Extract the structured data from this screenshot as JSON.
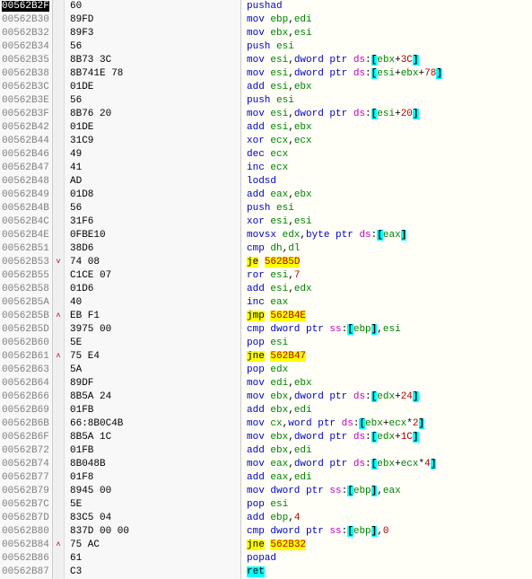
{
  "rows": [
    {
      "addr": "00562B2F",
      "addr_hl": true,
      "jmp": "",
      "bytes": "60",
      "asm": [
        [
          "mnem",
          "pushad"
        ]
      ]
    },
    {
      "addr": "00562B30",
      "jmp": "",
      "bytes": "89FD",
      "asm": [
        [
          "mnem",
          "mov "
        ],
        [
          "reg",
          "ebp"
        ],
        [
          "",
          ","
        ],
        [
          "reg",
          "edi"
        ]
      ]
    },
    {
      "addr": "00562B32",
      "jmp": "",
      "bytes": "89F3",
      "asm": [
        [
          "mnem",
          "mov "
        ],
        [
          "reg",
          "ebx"
        ],
        [
          "",
          ","
        ],
        [
          "reg",
          "esi"
        ]
      ]
    },
    {
      "addr": "00562B34",
      "jmp": "",
      "bytes": "56",
      "asm": [
        [
          "mnem",
          "push "
        ],
        [
          "reg",
          "esi"
        ]
      ]
    },
    {
      "addr": "00562B35",
      "jmp": "",
      "bytes": "8B73 3C",
      "asm": [
        [
          "mnem",
          "mov "
        ],
        [
          "reg",
          "esi"
        ],
        [
          "",
          ","
        ],
        [
          "mnem",
          "dword ptr "
        ],
        [
          "seg",
          "ds"
        ],
        [
          "",
          ":"
        ],
        [
          "brkt",
          "["
        ],
        [
          "reg",
          "ebx"
        ],
        [
          "",
          "+"
        ],
        [
          "num",
          "3C"
        ],
        [
          "brkt",
          "]"
        ]
      ]
    },
    {
      "addr": "00562B38",
      "jmp": "",
      "bytes": "8B741E 78",
      "asm": [
        [
          "mnem",
          "mov "
        ],
        [
          "reg",
          "esi"
        ],
        [
          "",
          ","
        ],
        [
          "mnem",
          "dword ptr "
        ],
        [
          "seg",
          "ds"
        ],
        [
          "",
          ":"
        ],
        [
          "brkt",
          "["
        ],
        [
          "reg",
          "esi"
        ],
        [
          "",
          "+"
        ],
        [
          "reg",
          "ebx"
        ],
        [
          "",
          "+"
        ],
        [
          "num",
          "78"
        ],
        [
          "brkt",
          "]"
        ]
      ]
    },
    {
      "addr": "00562B3C",
      "jmp": "",
      "bytes": "01DE",
      "asm": [
        [
          "mnem",
          "add "
        ],
        [
          "reg",
          "esi"
        ],
        [
          "",
          ","
        ],
        [
          "reg",
          "ebx"
        ]
      ]
    },
    {
      "addr": "00562B3E",
      "jmp": "",
      "bytes": "56",
      "asm": [
        [
          "mnem",
          "push "
        ],
        [
          "reg",
          "esi"
        ]
      ]
    },
    {
      "addr": "00562B3F",
      "jmp": "",
      "bytes": "8B76 20",
      "asm": [
        [
          "mnem",
          "mov "
        ],
        [
          "reg",
          "esi"
        ],
        [
          "",
          ","
        ],
        [
          "mnem",
          "dword ptr "
        ],
        [
          "seg",
          "ds"
        ],
        [
          "",
          ":"
        ],
        [
          "brkt",
          "["
        ],
        [
          "reg",
          "esi"
        ],
        [
          "",
          "+"
        ],
        [
          "num",
          "20"
        ],
        [
          "brkt",
          "]"
        ]
      ]
    },
    {
      "addr": "00562B42",
      "jmp": "",
      "bytes": "01DE",
      "asm": [
        [
          "mnem",
          "add "
        ],
        [
          "reg",
          "esi"
        ],
        [
          "",
          ","
        ],
        [
          "reg",
          "ebx"
        ]
      ]
    },
    {
      "addr": "00562B44",
      "jmp": "",
      "bytes": "31C9",
      "asm": [
        [
          "mnem",
          "xor "
        ],
        [
          "reg",
          "ecx"
        ],
        [
          "",
          ","
        ],
        [
          "reg",
          "ecx"
        ]
      ]
    },
    {
      "addr": "00562B46",
      "jmp": "",
      "bytes": "49",
      "asm": [
        [
          "mnem",
          "dec "
        ],
        [
          "reg",
          "ecx"
        ]
      ]
    },
    {
      "addr": "00562B47",
      "jmp": "",
      "bytes": "41",
      "asm": [
        [
          "mnem",
          "inc "
        ],
        [
          "reg",
          "ecx"
        ]
      ]
    },
    {
      "addr": "00562B48",
      "jmp": "",
      "bytes": "AD",
      "asm": [
        [
          "mnem",
          "lodsd"
        ]
      ]
    },
    {
      "addr": "00562B49",
      "jmp": "",
      "bytes": "01D8",
      "asm": [
        [
          "mnem",
          "add "
        ],
        [
          "reg",
          "eax"
        ],
        [
          "",
          ","
        ],
        [
          "reg",
          "ebx"
        ]
      ]
    },
    {
      "addr": "00562B4B",
      "jmp": "",
      "bytes": "56",
      "asm": [
        [
          "mnem",
          "push "
        ],
        [
          "reg",
          "esi"
        ]
      ]
    },
    {
      "addr": "00562B4C",
      "jmp": "",
      "bytes": "31F6",
      "asm": [
        [
          "mnem",
          "xor "
        ],
        [
          "reg",
          "esi"
        ],
        [
          "",
          ","
        ],
        [
          "reg",
          "esi"
        ]
      ]
    },
    {
      "addr": "00562B4E",
      "jmp": "",
      "bytes": "0FBE10",
      "asm": [
        [
          "mnem",
          "movsx "
        ],
        [
          "reg",
          "edx"
        ],
        [
          "",
          ","
        ],
        [
          "mnem",
          "byte ptr "
        ],
        [
          "seg",
          "ds"
        ],
        [
          "",
          ":"
        ],
        [
          "brkt",
          "["
        ],
        [
          "reg",
          "eax"
        ],
        [
          "brkt",
          "]"
        ]
      ]
    },
    {
      "addr": "00562B51",
      "jmp": "",
      "bytes": "38D6",
      "asm": [
        [
          "mnem",
          "cmp "
        ],
        [
          "reg",
          "dh"
        ],
        [
          "",
          ","
        ],
        [
          "reg",
          "dl"
        ]
      ]
    },
    {
      "addr": "00562B53",
      "jmp": "˅",
      "bytes": "74 08",
      "asm": [
        [
          "jmpm",
          "je"
        ],
        [
          "",
          " "
        ],
        [
          "tgt",
          "562B5D"
        ]
      ]
    },
    {
      "addr": "00562B55",
      "jmp": "",
      "bytes": "C1CE 07",
      "asm": [
        [
          "mnem",
          "ror "
        ],
        [
          "reg",
          "esi"
        ],
        [
          "",
          ","
        ],
        [
          "num",
          "7"
        ]
      ]
    },
    {
      "addr": "00562B58",
      "jmp": "",
      "bytes": "01D6",
      "asm": [
        [
          "mnem",
          "add "
        ],
        [
          "reg",
          "esi"
        ],
        [
          "",
          ","
        ],
        [
          "reg",
          "edx"
        ]
      ]
    },
    {
      "addr": "00562B5A",
      "jmp": "",
      "bytes": "40",
      "asm": [
        [
          "mnem",
          "inc "
        ],
        [
          "reg",
          "eax"
        ]
      ]
    },
    {
      "addr": "00562B5B",
      "jmp": "˄",
      "bytes": "EB F1",
      "asm": [
        [
          "jmpm",
          "jmp"
        ],
        [
          "",
          " "
        ],
        [
          "tgt",
          "562B4E"
        ]
      ]
    },
    {
      "addr": "00562B5D",
      "jmp": "",
      "bytes": "3975 00",
      "asm": [
        [
          "mnem",
          "cmp "
        ],
        [
          "mnem",
          "dword ptr "
        ],
        [
          "seg",
          "ss"
        ],
        [
          "",
          ":"
        ],
        [
          "brkt",
          "["
        ],
        [
          "reg",
          "ebp"
        ],
        [
          "brkt",
          "]"
        ],
        [
          "",
          ","
        ],
        [
          "reg",
          "esi"
        ]
      ]
    },
    {
      "addr": "00562B60",
      "jmp": "",
      "bytes": "5E",
      "asm": [
        [
          "mnem",
          "pop "
        ],
        [
          "reg",
          "esi"
        ]
      ]
    },
    {
      "addr": "00562B61",
      "jmp": "˄",
      "bytes": "75 E4",
      "asm": [
        [
          "jmpm",
          "jne"
        ],
        [
          "",
          " "
        ],
        [
          "tgt",
          "562B47"
        ]
      ]
    },
    {
      "addr": "00562B63",
      "jmp": "",
      "bytes": "5A",
      "asm": [
        [
          "mnem",
          "pop "
        ],
        [
          "reg",
          "edx"
        ]
      ]
    },
    {
      "addr": "00562B64",
      "jmp": "",
      "bytes": "89DF",
      "asm": [
        [
          "mnem",
          "mov "
        ],
        [
          "reg",
          "edi"
        ],
        [
          "",
          ","
        ],
        [
          "reg",
          "ebx"
        ]
      ]
    },
    {
      "addr": "00562B66",
      "jmp": "",
      "bytes": "8B5A 24",
      "asm": [
        [
          "mnem",
          "mov "
        ],
        [
          "reg",
          "ebx"
        ],
        [
          "",
          ","
        ],
        [
          "mnem",
          "dword ptr "
        ],
        [
          "seg",
          "ds"
        ],
        [
          "",
          ":"
        ],
        [
          "brkt",
          "["
        ],
        [
          "reg",
          "edx"
        ],
        [
          "",
          "+"
        ],
        [
          "num",
          "24"
        ],
        [
          "brkt",
          "]"
        ]
      ]
    },
    {
      "addr": "00562B69",
      "jmp": "",
      "bytes": "01FB",
      "asm": [
        [
          "mnem",
          "add "
        ],
        [
          "reg",
          "ebx"
        ],
        [
          "",
          ","
        ],
        [
          "reg",
          "edi"
        ]
      ]
    },
    {
      "addr": "00562B6B",
      "jmp": "",
      "bytes": "66:8B0C4B",
      "asm": [
        [
          "mnem",
          "mov "
        ],
        [
          "reg",
          "cx"
        ],
        [
          "",
          ","
        ],
        [
          "mnem",
          "word ptr "
        ],
        [
          "seg",
          "ds"
        ],
        [
          "",
          ":"
        ],
        [
          "brkt",
          "["
        ],
        [
          "reg",
          "ebx"
        ],
        [
          "",
          "+"
        ],
        [
          "reg",
          "ecx"
        ],
        [
          "",
          "*"
        ],
        [
          "num",
          "2"
        ],
        [
          "brkt",
          "]"
        ]
      ]
    },
    {
      "addr": "00562B6F",
      "jmp": "",
      "bytes": "8B5A 1C",
      "asm": [
        [
          "mnem",
          "mov "
        ],
        [
          "reg",
          "ebx"
        ],
        [
          "",
          ","
        ],
        [
          "mnem",
          "dword ptr "
        ],
        [
          "seg",
          "ds"
        ],
        [
          "",
          ":"
        ],
        [
          "brkt",
          "["
        ],
        [
          "reg",
          "edx"
        ],
        [
          "",
          "+"
        ],
        [
          "num",
          "1C"
        ],
        [
          "brkt",
          "]"
        ]
      ]
    },
    {
      "addr": "00562B72",
      "jmp": "",
      "bytes": "01FB",
      "asm": [
        [
          "mnem",
          "add "
        ],
        [
          "reg",
          "ebx"
        ],
        [
          "",
          ","
        ],
        [
          "reg",
          "edi"
        ]
      ]
    },
    {
      "addr": "00562B74",
      "jmp": "",
      "bytes": "8B048B",
      "asm": [
        [
          "mnem",
          "mov "
        ],
        [
          "reg",
          "eax"
        ],
        [
          "",
          ","
        ],
        [
          "mnem",
          "dword ptr "
        ],
        [
          "seg",
          "ds"
        ],
        [
          "",
          ":"
        ],
        [
          "brkt",
          "["
        ],
        [
          "reg",
          "ebx"
        ],
        [
          "",
          "+"
        ],
        [
          "reg",
          "ecx"
        ],
        [
          "",
          "*"
        ],
        [
          "num",
          "4"
        ],
        [
          "brkt",
          "]"
        ]
      ]
    },
    {
      "addr": "00562B77",
      "jmp": "",
      "bytes": "01F8",
      "asm": [
        [
          "mnem",
          "add "
        ],
        [
          "reg",
          "eax"
        ],
        [
          "",
          ","
        ],
        [
          "reg",
          "edi"
        ]
      ]
    },
    {
      "addr": "00562B79",
      "jmp": "",
      "bytes": "8945 00",
      "asm": [
        [
          "mnem",
          "mov "
        ],
        [
          "mnem",
          "dword ptr "
        ],
        [
          "seg",
          "ss"
        ],
        [
          "",
          ":"
        ],
        [
          "brkt",
          "["
        ],
        [
          "reg",
          "ebp"
        ],
        [
          "brkt",
          "]"
        ],
        [
          "",
          ","
        ],
        [
          "reg",
          "eax"
        ]
      ]
    },
    {
      "addr": "00562B7C",
      "jmp": "",
      "bytes": "5E",
      "asm": [
        [
          "mnem",
          "pop "
        ],
        [
          "reg",
          "esi"
        ]
      ]
    },
    {
      "addr": "00562B7D",
      "jmp": "",
      "bytes": "83C5 04",
      "asm": [
        [
          "mnem",
          "add "
        ],
        [
          "reg",
          "ebp"
        ],
        [
          "",
          ","
        ],
        [
          "num",
          "4"
        ]
      ]
    },
    {
      "addr": "00562B80",
      "jmp": "",
      "bytes": "837D 00 00",
      "asm": [
        [
          "mnem",
          "cmp "
        ],
        [
          "mnem",
          "dword ptr "
        ],
        [
          "seg",
          "ss"
        ],
        [
          "",
          ":"
        ],
        [
          "brkt",
          "["
        ],
        [
          "reg",
          "ebp"
        ],
        [
          "brkt",
          "]"
        ],
        [
          "",
          ","
        ],
        [
          "num",
          "0"
        ]
      ]
    },
    {
      "addr": "00562B84",
      "jmp": "˄",
      "bytes": "75 AC",
      "asm": [
        [
          "jmpm",
          "jne"
        ],
        [
          "",
          " "
        ],
        [
          "tgt",
          "562B32"
        ]
      ]
    },
    {
      "addr": "00562B86",
      "jmp": "",
      "bytes": "61",
      "asm": [
        [
          "mnem",
          "popad"
        ]
      ]
    },
    {
      "addr": "00562B87",
      "jmp": "",
      "bytes": "C3",
      "asm": [
        [
          "ret",
          "ret"
        ]
      ]
    }
  ]
}
